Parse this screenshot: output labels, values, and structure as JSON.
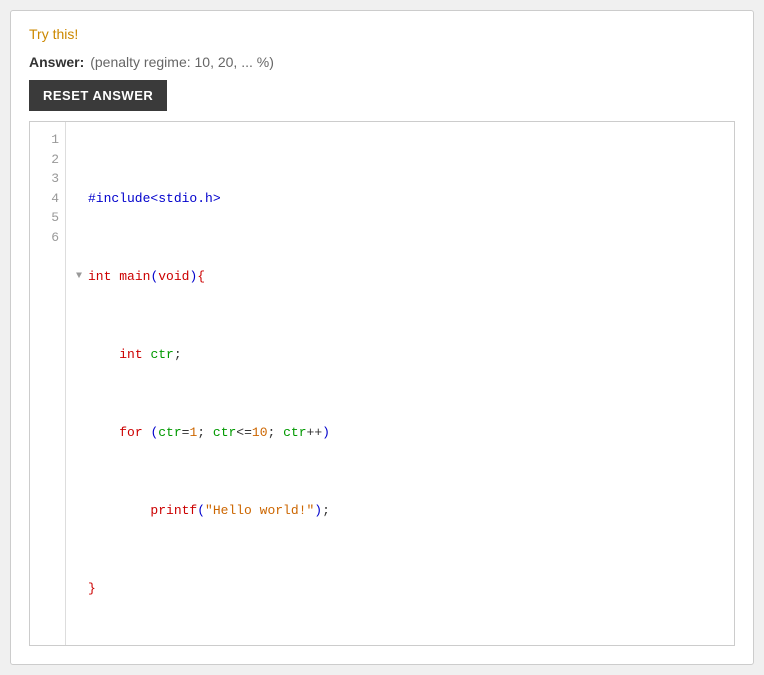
{
  "page": {
    "try_this_label": "Try this!",
    "answer_label": "Answer:",
    "penalty_text": "(penalty regime: 10, 20, ... %)",
    "reset_button_label": "RESET ANSWER",
    "code": {
      "lines": [
        {
          "number": "1",
          "fold": "",
          "content": "#include<stdio.h>"
        },
        {
          "number": "2",
          "fold": "▼",
          "content": "int main(void){"
        },
        {
          "number": "3",
          "fold": "",
          "content": "    int ctr;"
        },
        {
          "number": "4",
          "fold": "",
          "content": "    for (ctr=1; ctr<=10; ctr++)"
        },
        {
          "number": "5",
          "fold": "",
          "content": "        printf(\"Hello world!\");"
        },
        {
          "number": "6",
          "fold": "",
          "content": "}"
        }
      ]
    }
  }
}
